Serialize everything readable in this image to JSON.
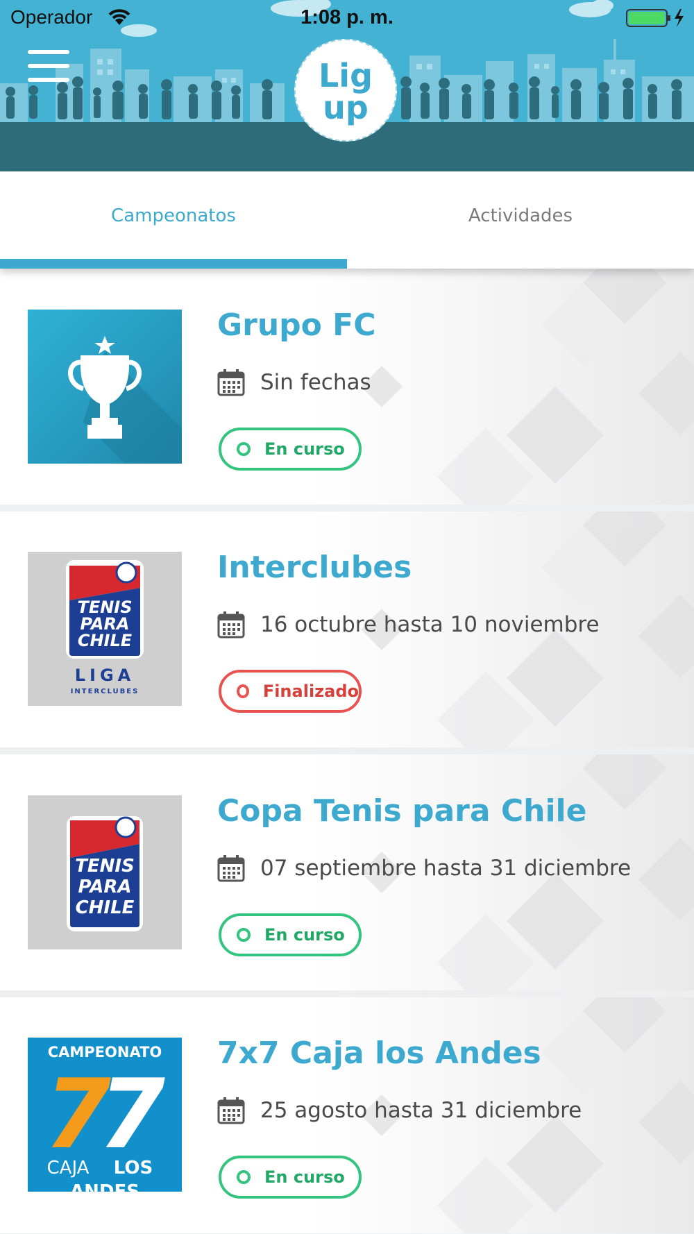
{
  "status_bar": {
    "carrier": "Operador",
    "time": "1:08 p. m."
  },
  "header": {
    "logo_text": "Lig up",
    "menu_icon": "hamburger-menu-icon"
  },
  "tabs": [
    {
      "label": "Campeonatos",
      "active": true
    },
    {
      "label": "Actividades",
      "active": false
    }
  ],
  "tournaments": [
    {
      "title": "Grupo FC",
      "dates": "Sin fechas",
      "status": "En curso",
      "status_color": "#33c47f",
      "image": "trophy-icon"
    },
    {
      "title": "Interclubes",
      "dates": "16 octubre hasta 10 noviembre",
      "status": "Finalizado",
      "status_color": "#e9534f",
      "image": "tenis-para-chile-liga-logo",
      "image_text": [
        "TENIS",
        "PARA",
        "CHILE",
        "LIGA",
        "INTERCLUBES"
      ]
    },
    {
      "title": "Copa Tenis para Chile",
      "dates": "07 septiembre hasta 31 diciembre",
      "status": "En curso",
      "status_color": "#33c47f",
      "image": "tenis-para-chile-logo",
      "image_text": [
        "TENIS",
        "PARA",
        "CHILE"
      ]
    },
    {
      "title": "7x7 Caja los Andes",
      "dates": "25 agosto hasta 31 diciembre",
      "status": "En curso",
      "status_color": "#33c47f",
      "image": "campeonato-7x7-logo",
      "image_text": [
        "CAMPEONATO",
        "7",
        "7",
        "CAJA",
        "LOS",
        "ANDES"
      ]
    }
  ],
  "colors": {
    "brand": "#3ea9cf",
    "header_sky": "#44b3d3",
    "header_ground": "#2f6c7a",
    "in_progress": "#33c47f",
    "finished": "#e9534f"
  }
}
